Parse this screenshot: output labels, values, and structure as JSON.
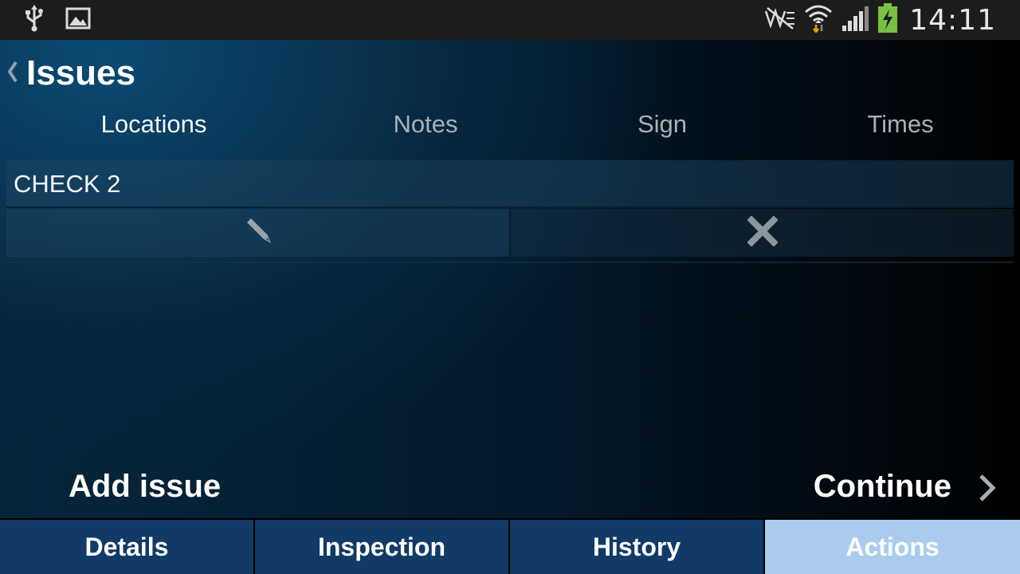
{
  "status_bar": {
    "time": "14:11",
    "left_icons": [
      "usb-icon",
      "image-icon"
    ],
    "right_icons": [
      "nfc-icon",
      "wifi-icon",
      "signal-icon",
      "battery-charging-icon"
    ]
  },
  "header": {
    "title": "Issues"
  },
  "tabs": [
    {
      "label": "Locations",
      "active": true
    },
    {
      "label": "Notes",
      "active": false
    },
    {
      "label": "Sign",
      "active": false
    },
    {
      "label": "Times",
      "active": false
    }
  ],
  "issues": [
    {
      "label": "CHECK 2",
      "actions": [
        "pencil-icon",
        "close-icon"
      ]
    }
  ],
  "footer_actions": {
    "add_issue": "Add issue",
    "continue": "Continue"
  },
  "bottom_tabs": [
    {
      "label": "Details",
      "selected": false
    },
    {
      "label": "Inspection",
      "selected": false
    },
    {
      "label": "History",
      "selected": false
    },
    {
      "label": "Actions",
      "selected": true
    }
  ],
  "colors": {
    "bottom_tab": "#113a66",
    "bottom_tab_selected": "#abcbee",
    "status_bar": "#1c1c1c",
    "battery": "#79c142"
  }
}
